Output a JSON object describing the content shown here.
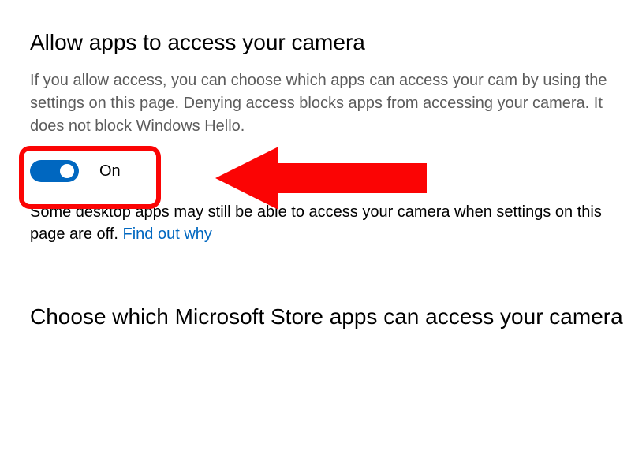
{
  "main": {
    "heading1": "Allow apps to access your camera",
    "description1": "If you allow access, you can choose which apps can access your cam by using the settings on this page. Denying access blocks apps from accessing your camera. It does not block Windows Hello.",
    "toggle": {
      "state_label": "On",
      "is_on": true
    },
    "desktop_note_text": "Some desktop apps may still be able to access your camera when settings on this page are off. ",
    "desktop_note_link": "Find out why",
    "heading2": "Choose which Microsoft Store apps can access your camera",
    "annotation": {
      "highlight_color": "#fb0404",
      "arrow_color": "#fb0404"
    }
  }
}
